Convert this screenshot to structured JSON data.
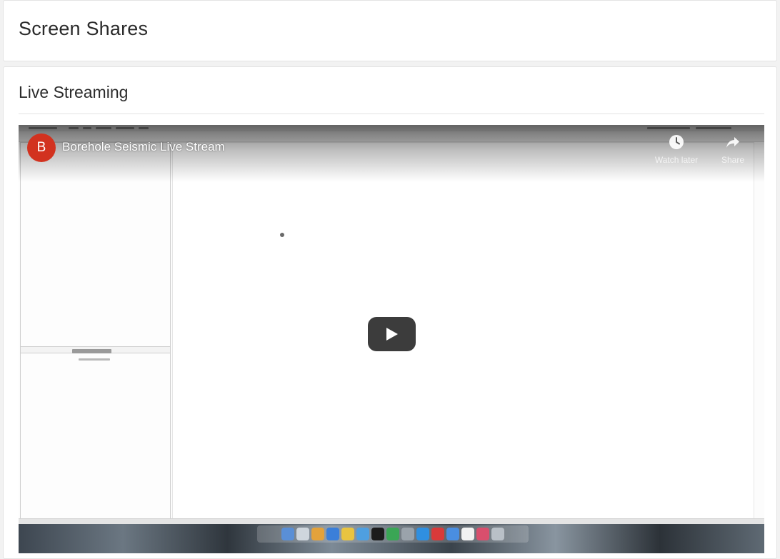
{
  "page": {
    "title": "Screen Shares"
  },
  "live_section": {
    "title": "Live Streaming"
  },
  "player": {
    "channel_initial": "B",
    "video_title": "Borehole Seismic Live Stream",
    "actions": [
      {
        "label": "Watch later",
        "icon": "clock-icon"
      },
      {
        "label": "Share",
        "icon": "share-arrow-icon"
      }
    ],
    "play_icon": "play-icon",
    "colors": {
      "avatar": "#d2321f",
      "play_button": "#222222"
    }
  }
}
